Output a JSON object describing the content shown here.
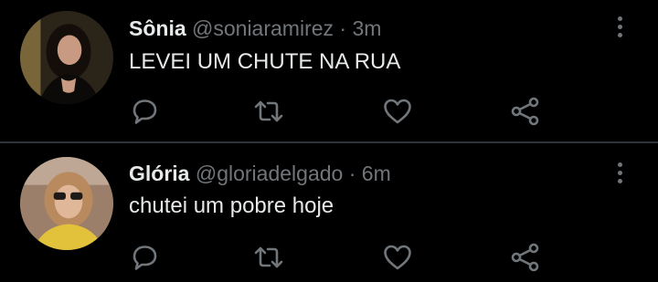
{
  "tweets": [
    {
      "name": "Sônia",
      "handle": "@soniaramirez",
      "separator": "·",
      "time": "3m",
      "text": "LEVEI UM CHUTE NA RUA",
      "avatar_icon": "woman-portrait-dark-background"
    },
    {
      "name": "Glória",
      "handle": "@gloriadelgado",
      "separator": "·",
      "time": "6m",
      "text": "chutei um pobre hoje",
      "avatar_icon": "woman-portrait-sunglasses"
    }
  ],
  "actions": [
    "reply-icon",
    "retweet-icon",
    "like-icon",
    "share-icon"
  ],
  "colors": {
    "background": "#000000",
    "primary_text": "#e7e9ea",
    "secondary_text": "#71767b",
    "divider": "#2f3336"
  }
}
